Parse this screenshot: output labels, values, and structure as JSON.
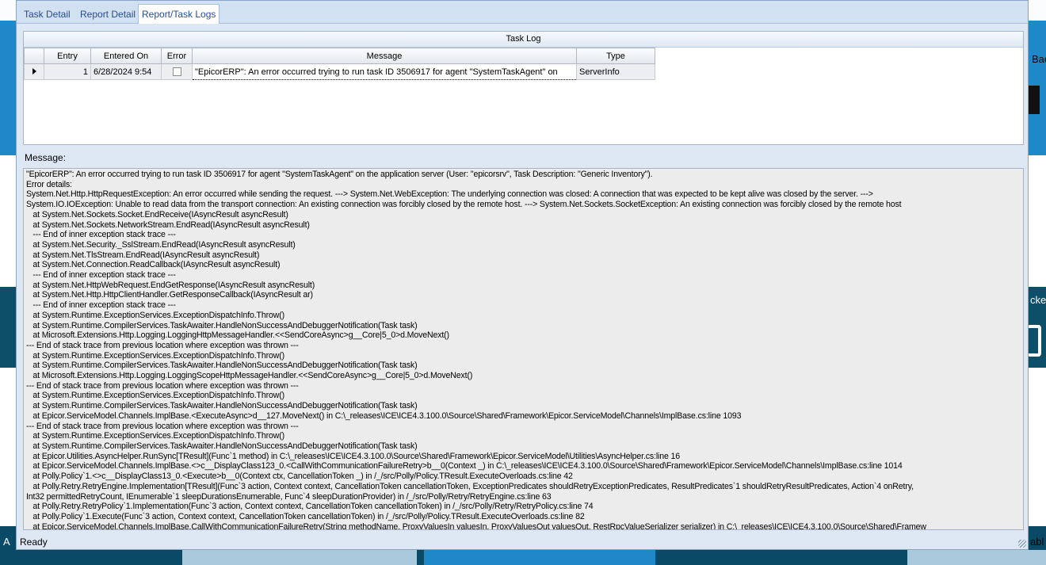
{
  "tabs": [
    {
      "label": "Task Detail",
      "active": false
    },
    {
      "label": "Report Detail",
      "active": false
    },
    {
      "label": "Report/Task Logs",
      "active": true
    }
  ],
  "task_log": {
    "caption": "Task Log",
    "columns": [
      "Entry",
      "Entered On",
      "Error",
      "Message",
      "Type"
    ],
    "rows": [
      {
        "entry": "1",
        "entered_on": "6/28/2024 9:54",
        "error": false,
        "message": "\"EpicorERP\": An error occurred trying to run task ID 3506917 for agent \"SystemTaskAgent\" on",
        "type": "ServerInfo"
      }
    ]
  },
  "message_label": "Message:",
  "message_lines": [
    "\"EpicorERP\": An error occurred trying to run task ID 3506917 for agent \"SystemTaskAgent\" on the application server (User: \"epicorsrv\", Task Description: \"Generic Inventory\").",
    "Error details:",
    "System.Net.Http.HttpRequestException: An error occurred while sending the request. ---> System.Net.WebException: The underlying connection was closed: A connection that was expected to be kept alive was closed by the server. --->",
    "System.IO.IOException: Unable to read data from the transport connection: An existing connection was forcibly closed by the remote host. ---> System.Net.Sockets.SocketException: An existing connection was forcibly closed by the remote host",
    "   at System.Net.Sockets.Socket.EndReceive(IAsyncResult asyncResult)",
    "   at System.Net.Sockets.NetworkStream.EndRead(IAsyncResult asyncResult)",
    "   --- End of inner exception stack trace ---",
    "   at System.Net.Security._SslStream.EndRead(IAsyncResult asyncResult)",
    "   at System.Net.TlsStream.EndRead(IAsyncResult asyncResult)",
    "   at System.Net.Connection.ReadCallback(IAsyncResult asyncResult)",
    "   --- End of inner exception stack trace ---",
    "   at System.Net.HttpWebRequest.EndGetResponse(IAsyncResult asyncResult)",
    "   at System.Net.Http.HttpClientHandler.GetResponseCallback(IAsyncResult ar)",
    "   --- End of inner exception stack trace ---",
    "   at System.Runtime.ExceptionServices.ExceptionDispatchInfo.Throw()",
    "   at System.Runtime.CompilerServices.TaskAwaiter.HandleNonSuccessAndDebuggerNotification(Task task)",
    "   at Microsoft.Extensions.Http.Logging.LoggingHttpMessageHandler.<<SendCoreAsync>g__Core|5_0>d.MoveNext()",
    "--- End of stack trace from previous location where exception was thrown ---",
    "   at System.Runtime.ExceptionServices.ExceptionDispatchInfo.Throw()",
    "   at System.Runtime.CompilerServices.TaskAwaiter.HandleNonSuccessAndDebuggerNotification(Task task)",
    "   at Microsoft.Extensions.Http.Logging.LoggingScopeHttpMessageHandler.<<SendCoreAsync>g__Core|5_0>d.MoveNext()",
    "--- End of stack trace from previous location where exception was thrown ---",
    "   at System.Runtime.ExceptionServices.ExceptionDispatchInfo.Throw()",
    "   at System.Runtime.CompilerServices.TaskAwaiter.HandleNonSuccessAndDebuggerNotification(Task task)",
    "   at Epicor.ServiceModel.Channels.ImplBase.<ExecuteAsync>d__127.MoveNext() in C:\\_releases\\ICE\\ICE4.3.100.0\\Source\\Shared\\Framework\\Epicor.ServiceModel\\Channels\\ImplBase.cs:line 1093",
    "--- End of stack trace from previous location where exception was thrown ---",
    "   at System.Runtime.ExceptionServices.ExceptionDispatchInfo.Throw()",
    "   at System.Runtime.CompilerServices.TaskAwaiter.HandleNonSuccessAndDebuggerNotification(Task task)",
    "   at Epicor.Utilities.AsyncHelper.RunSync[TResult](Func`1 method) in C:\\_releases\\ICE\\ICE4.3.100.0\\Source\\Shared\\Framework\\Epicor.ServiceModel\\Utilities\\AsyncHelper.cs:line 16",
    "   at Epicor.ServiceModel.Channels.ImplBase.<>c__DisplayClass123_0.<CallWithCommunicationFailureRetry>b__0(Context _) in C:\\_releases\\ICE\\ICE4.3.100.0\\Source\\Shared\\Framework\\Epicor.ServiceModel\\Channels\\ImplBase.cs:line 1014",
    "   at Polly.Policy`1.<>c__DisplayClass13_0.<Execute>b__0(Context ctx, CancellationToken _) in /_/src/Polly/Policy.TResult.ExecuteOverloads.cs:line 42",
    "   at Polly.Retry.RetryEngine.Implementation[TResult](Func`3 action, Context context, CancellationToken cancellationToken, ExceptionPredicates shouldRetryExceptionPredicates, ResultPredicates`1 shouldRetryResultPredicates, Action`4 onRetry,",
    "Int32 permittedRetryCount, IEnumerable`1 sleepDurationsEnumerable, Func`4 sleepDurationProvider) in /_/src/Polly/Retry/RetryEngine.cs:line 63",
    "   at Polly.Retry.RetryPolicy`1.Implementation(Func`3 action, Context context, CancellationToken cancellationToken) in /_/src/Polly/Retry/RetryPolicy.cs:line 74",
    "   at Polly.Policy`1.Execute(Func`3 action, Context context, CancellationToken cancellationToken) in /_/src/Polly/Policy.TResult.ExecuteOverloads.cs:line 82",
    "   at Epicor.ServiceModel.Channels.ImplBase.CallWithCommunicationFailureRetry(String methodName, ProxyValuesIn valuesIn, ProxyValuesOut valuesOut, RestRpcValueSerializer serializer) in C:\\_releases\\ICE\\ICE4.3.100.0\\Source\\Shared\\Framew"
  ],
  "status": "Ready",
  "background": {
    "right_labels": [
      "Bac",
      "cke",
      "abl"
    ],
    "left_label": "A"
  }
}
